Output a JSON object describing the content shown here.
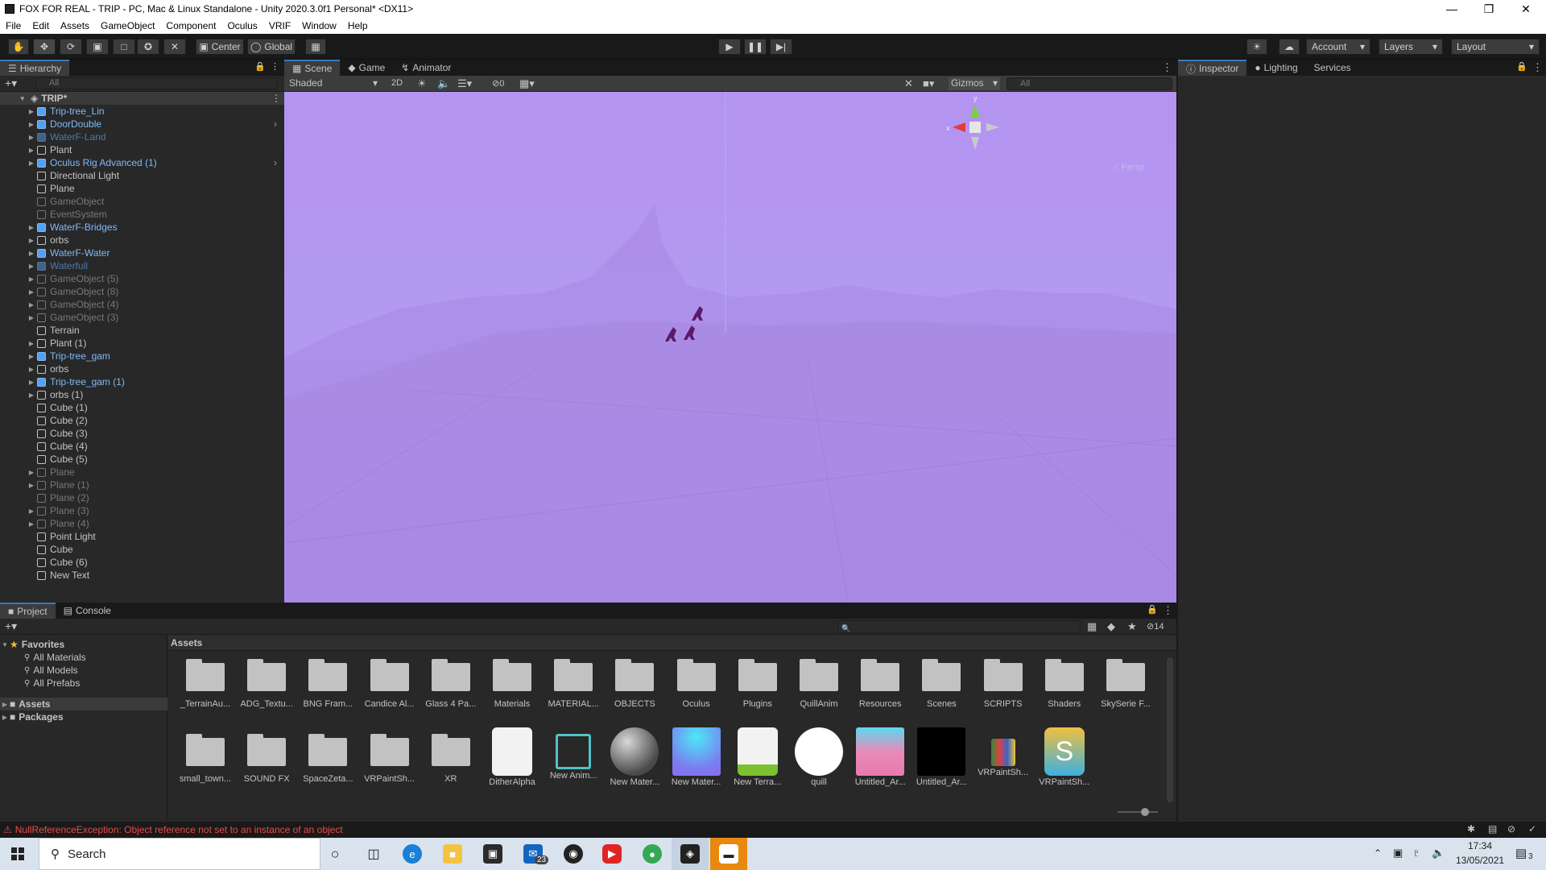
{
  "window": {
    "title": "FOX FOR REAL - TRIP - PC, Mac & Linux Standalone - Unity 2020.3.0f1 Personal* <DX11>"
  },
  "menu": [
    "File",
    "Edit",
    "Assets",
    "GameObject",
    "Component",
    "Oculus",
    "VRIF",
    "Window",
    "Help"
  ],
  "toolbar": {
    "center_label": "Center",
    "global_label": "Global",
    "account_label": "Account",
    "layers_label": "Layers",
    "layout_label": "Layout"
  },
  "hierarchy": {
    "tab_label": "Hierarchy",
    "search_placeholder": "All",
    "scene_name": "TRIP*",
    "items": [
      {
        "label": "Trip-tree_Lin",
        "style": "prefab",
        "expand": true
      },
      {
        "label": "DoorDouble",
        "style": "prefab",
        "expand": true
      },
      {
        "label": "WaterF-Land",
        "style": "disprefab",
        "expand": true
      },
      {
        "label": "Plant",
        "style": "normal",
        "expand": true
      },
      {
        "label": "Oculus Rig Advanced (1)",
        "style": "prefab",
        "expand": true
      },
      {
        "label": "Directional Light",
        "style": "normal",
        "expand": false
      },
      {
        "label": "Plane",
        "style": "normal",
        "expand": false
      },
      {
        "label": "GameObject",
        "style": "dis",
        "expand": false
      },
      {
        "label": "EventSystem",
        "style": "dis",
        "expand": false
      },
      {
        "label": "WaterF-Bridges",
        "style": "prefab",
        "expand": true
      },
      {
        "label": "orbs",
        "style": "normal",
        "expand": true
      },
      {
        "label": "WaterF-Water",
        "style": "prefab",
        "expand": true
      },
      {
        "label": "Waterfull",
        "style": "disprefab",
        "expand": true
      },
      {
        "label": "GameObject (5)",
        "style": "dis",
        "expand": true
      },
      {
        "label": "GameObject (8)",
        "style": "dis",
        "expand": true
      },
      {
        "label": "GameObject (4)",
        "style": "dis",
        "expand": true
      },
      {
        "label": "GameObject (3)",
        "style": "dis",
        "expand": true
      },
      {
        "label": "Terrain",
        "style": "normal",
        "expand": false
      },
      {
        "label": "Plant (1)",
        "style": "normal",
        "expand": true
      },
      {
        "label": "Trip-tree_gam",
        "style": "prefab",
        "expand": true
      },
      {
        "label": "orbs",
        "style": "normal",
        "expand": true
      },
      {
        "label": "Trip-tree_gam (1)",
        "style": "prefab",
        "expand": true
      },
      {
        "label": "orbs (1)",
        "style": "normal",
        "expand": true
      },
      {
        "label": "Cube (1)",
        "style": "normal",
        "expand": false
      },
      {
        "label": "Cube (2)",
        "style": "normal",
        "expand": false
      },
      {
        "label": "Cube (3)",
        "style": "normal",
        "expand": false
      },
      {
        "label": "Cube (4)",
        "style": "normal",
        "expand": false
      },
      {
        "label": "Cube (5)",
        "style": "normal",
        "expand": false
      },
      {
        "label": "Plane",
        "style": "dis",
        "expand": true
      },
      {
        "label": "Plane (1)",
        "style": "dis",
        "expand": true
      },
      {
        "label": "Plane (2)",
        "style": "dis",
        "expand": false
      },
      {
        "label": "Plane (3)",
        "style": "dis",
        "expand": true
      },
      {
        "label": "Plane (4)",
        "style": "dis",
        "expand": true
      },
      {
        "label": "Point Light",
        "style": "normal",
        "expand": false
      },
      {
        "label": "Cube",
        "style": "normal",
        "expand": false
      },
      {
        "label": "Cube (6)",
        "style": "normal",
        "expand": false
      },
      {
        "label": "New Text",
        "style": "normal",
        "expand": false
      }
    ]
  },
  "scene": {
    "tabs": [
      "Scene",
      "Game",
      "Animator"
    ],
    "shading": "Shaded",
    "mode_2d": "2D",
    "hidden_count": "0",
    "gizmos_label": "Gizmos",
    "search_placeholder": "All",
    "persp_label": "< Persp",
    "gizmo_axes": {
      "x": "x",
      "y": "y"
    },
    "sky_color": "#b595f0"
  },
  "inspector": {
    "tabs": [
      "Inspector",
      "Lighting",
      "Services"
    ]
  },
  "project": {
    "tabs": [
      "Project",
      "Console"
    ],
    "hidden_count": "14",
    "favorites_label": "Favorites",
    "favorites": [
      "All Materials",
      "All Models",
      "All Prefabs"
    ],
    "roots": [
      "Assets",
      "Packages"
    ],
    "breadcrumb": "Assets",
    "assets": [
      {
        "name": "_TerrainAu...",
        "kind": "folder"
      },
      {
        "name": "ADG_Textu...",
        "kind": "folder"
      },
      {
        "name": "BNG Fram...",
        "kind": "folder"
      },
      {
        "name": "Candice Al...",
        "kind": "folder"
      },
      {
        "name": "Glass 4 Pa...",
        "kind": "folder"
      },
      {
        "name": "Materials",
        "kind": "folder"
      },
      {
        "name": "MATERIAL...",
        "kind": "folder"
      },
      {
        "name": "OBJECTS",
        "kind": "folder"
      },
      {
        "name": "Oculus",
        "kind": "folder"
      },
      {
        "name": "Plugins",
        "kind": "folder"
      },
      {
        "name": "QuillAnim",
        "kind": "folder"
      },
      {
        "name": "Resources",
        "kind": "folder"
      },
      {
        "name": "Scenes",
        "kind": "folder"
      },
      {
        "name": "SCRIPTS",
        "kind": "folder"
      },
      {
        "name": "Shaders",
        "kind": "folder"
      },
      {
        "name": "SkySerie F...",
        "kind": "folder"
      },
      {
        "name": "small_town...",
        "kind": "folder"
      },
      {
        "name": "SOUND FX",
        "kind": "folder"
      },
      {
        "name": "SpaceZeta...",
        "kind": "folder"
      },
      {
        "name": "VRPaintSh...",
        "kind": "folder"
      },
      {
        "name": "XR",
        "kind": "folder"
      },
      {
        "name": "DitherAlpha",
        "kind": "doc"
      },
      {
        "name": "New Anim...",
        "kind": "anim"
      },
      {
        "name": "New Mater...",
        "kind": "sphere"
      },
      {
        "name": "New Mater...",
        "kind": "gradient-blue"
      },
      {
        "name": "New Terra...",
        "kind": "terrain"
      },
      {
        "name": "quill",
        "kind": "white"
      },
      {
        "name": "Untitled_Ar...",
        "kind": "gradient-pink"
      },
      {
        "name": "Untitled_Ar...",
        "kind": "black"
      },
      {
        "name": "VRPaintSh...",
        "kind": "package"
      },
      {
        "name": "VRPaintSh...",
        "kind": "s-icon"
      }
    ]
  },
  "status": {
    "error": "NullReferenceException: Object reference not set to an instance of an object"
  },
  "taskbar": {
    "search_placeholder": "Search",
    "mail_badge": "23",
    "time": "17:34",
    "date": "13/05/2021",
    "notif_count": "3"
  }
}
